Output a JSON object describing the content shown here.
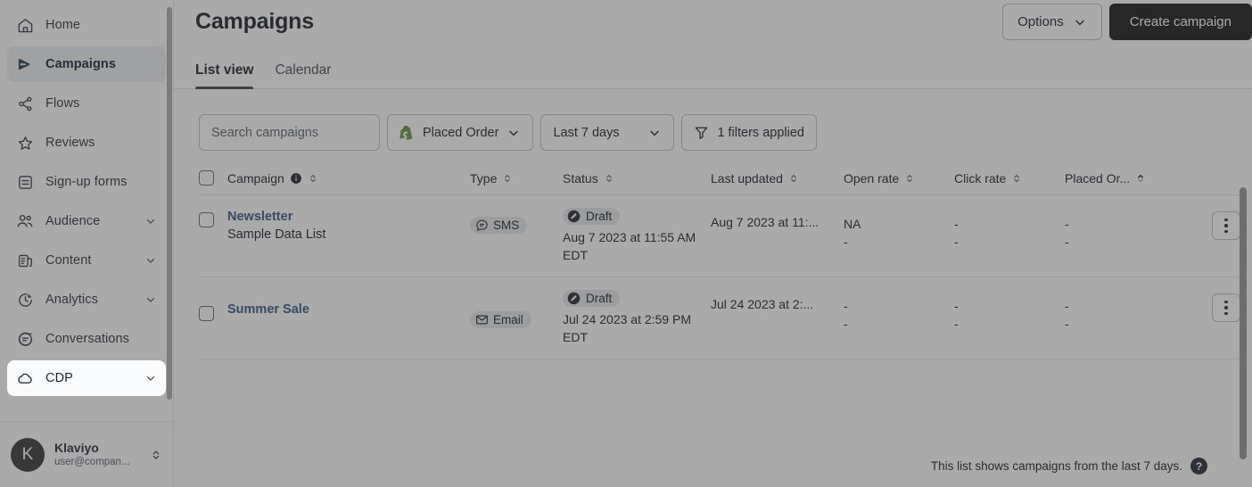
{
  "sidebar": {
    "items": [
      {
        "label": "Home",
        "icon": "home-icon",
        "expandable": false,
        "active": false
      },
      {
        "label": "Campaigns",
        "icon": "campaigns-icon",
        "expandable": false,
        "active": true
      },
      {
        "label": "Flows",
        "icon": "flows-icon",
        "expandable": false,
        "active": false
      },
      {
        "label": "Reviews",
        "icon": "star-icon",
        "expandable": false,
        "active": false
      },
      {
        "label": "Sign-up forms",
        "icon": "form-icon",
        "expandable": false,
        "active": false
      },
      {
        "label": "Audience",
        "icon": "people-icon",
        "expandable": true,
        "active": false
      },
      {
        "label": "Content",
        "icon": "content-icon",
        "expandable": true,
        "active": false
      },
      {
        "label": "Analytics",
        "icon": "pie-chart-icon",
        "expandable": true,
        "active": false
      },
      {
        "label": "Conversations",
        "icon": "conversations-icon",
        "expandable": false,
        "active": false
      },
      {
        "label": "CDP",
        "icon": "cloud-icon",
        "expandable": true,
        "active": false
      }
    ],
    "user": {
      "avatar_initial": "K",
      "name": "Klaviyo",
      "email": "user@compan...",
      "switcher_icon": "up-down-chevron-icon"
    }
  },
  "header": {
    "title": "Campaigns",
    "options_label": "Options",
    "options_icon": "chevron-down-icon",
    "create_label": "Create campaign"
  },
  "tabs": [
    {
      "label": "List view",
      "active": true
    },
    {
      "label": "Calendar",
      "active": false
    }
  ],
  "filters": {
    "search_placeholder": "Search campaigns",
    "search_value": "",
    "metric_label": "Placed Order",
    "metric_icon": "shopify-icon",
    "metric_icon_color": "#5E8E3E",
    "daterange_label": "Last 7 days",
    "filters_label": "1 filters applied",
    "filters_icon": "funnel-icon"
  },
  "table": {
    "columns": [
      {
        "label": "Campaign",
        "sortable": true,
        "info_icon": "info-icon",
        "sort": "none"
      },
      {
        "label": "Type",
        "sortable": true,
        "sort": "none"
      },
      {
        "label": "Status",
        "sortable": true,
        "sort": "none"
      },
      {
        "label": "Last updated",
        "sortable": true,
        "sort": "none"
      },
      {
        "label": "Open rate",
        "sortable": true,
        "sort": "none"
      },
      {
        "label": "Click rate",
        "sortable": true,
        "sort": "none"
      },
      {
        "label": "Placed Or...",
        "sortable": true,
        "sort": "asc"
      }
    ],
    "rows": [
      {
        "name": "Newsletter",
        "subtitle": "Sample Data List",
        "type": "SMS",
        "type_icon": "sms-icon",
        "status": "Draft",
        "status_icon": "draft-pencil-icon",
        "status_date": "Aug 7 2023 at 11:55 AM EDT",
        "last_updated": "Aug 7 2023 at 11:...",
        "open_rate_1": "NA",
        "open_rate_2": "-",
        "click_rate_1": "-",
        "click_rate_2": "-",
        "placed_order_1": "-",
        "placed_order_2": "-",
        "menu_icon": "kebab-menu-icon"
      },
      {
        "name": "Summer Sale",
        "subtitle": "",
        "type": "Email",
        "type_icon": "email-icon",
        "status": "Draft",
        "status_icon": "draft-pencil-icon",
        "status_date": "Jul 24 2023 at 2:59 PM EDT",
        "last_updated": "Jul 24 2023 at 2:...",
        "open_rate_1": "-",
        "open_rate_2": "-",
        "click_rate_1": "-",
        "click_rate_2": "-",
        "placed_order_1": "-",
        "placed_order_2": "-",
        "menu_icon": "kebab-menu-icon"
      }
    ]
  },
  "footer": {
    "note": "This list shows campaigns from the last 7 days.",
    "help_label": "?"
  },
  "colors": {
    "primary_button_bg": "#0e0e0e",
    "link": "#29507c",
    "active_tab_underline": "#36404a",
    "shopify_green": "#5E8E3E",
    "overlay": "rgba(70,70,70,0.46)"
  }
}
